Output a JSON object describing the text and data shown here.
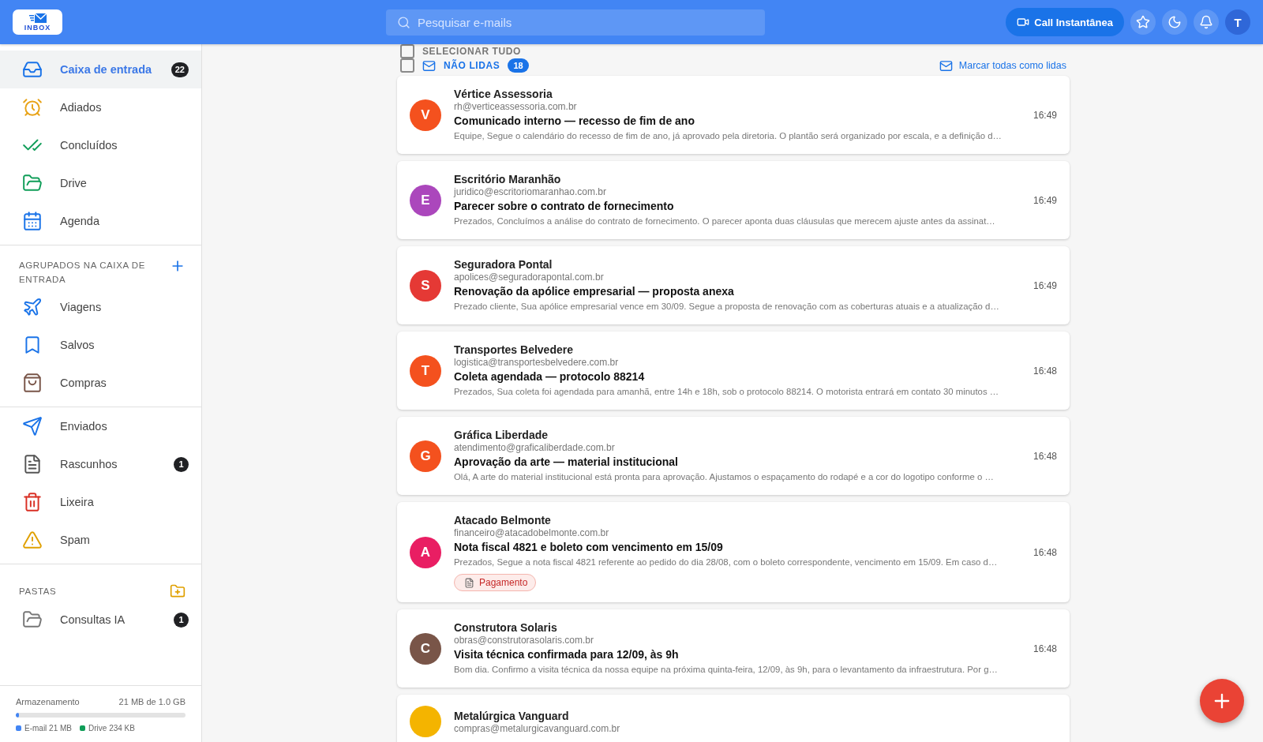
{
  "header": {
    "logo_text": "INBOX",
    "search": {
      "placeholder": "Pesquisar e-mails"
    },
    "call_button": "Call Instantânea",
    "avatar": "T"
  },
  "sidebar": {
    "main": [
      {
        "label": "Caixa de entrada",
        "count": "22",
        "selected": true
      },
      {
        "label": "Adiados",
        "selected": false
      },
      {
        "label": "Concluídos",
        "selected": false
      },
      {
        "label": "Drive",
        "selected": false
      },
      {
        "label": "Agenda",
        "selected": false
      }
    ],
    "grouped": {
      "title": "AGRUPADOS NA CAIXA DE ENTRADA",
      "items": [
        {
          "label": "Viagens",
          "selected": false
        },
        {
          "label": "Salvos",
          "selected": false
        },
        {
          "label": "Compras",
          "selected": false
        }
      ]
    },
    "system": [
      {
        "label": "Enviados",
        "selected": false
      },
      {
        "label": "Rascunhos",
        "count": "1",
        "selected": false
      },
      {
        "label": "Lixeira",
        "selected": false
      },
      {
        "label": "Spam",
        "selected": false
      }
    ],
    "folders": {
      "title": "PASTAS",
      "items": [
        {
          "label": "Consultas IA",
          "count": "1",
          "selected": false
        }
      ]
    },
    "storage": {
      "label": "Armazenamento",
      "usage": "21 MB de 1.0 GB",
      "level": 0.02,
      "legend": [
        {
          "label": "E-mail 21 MB",
          "color": "#4285f4"
        },
        {
          "label": "Drive 234 KB",
          "color": "#0f9d58"
        }
      ]
    }
  },
  "list": {
    "select_all": {
      "label": "SELECIONAR TUDO",
      "checked": false
    },
    "group": {
      "label": "NÃO LIDAS",
      "count": "18",
      "checked": false,
      "mark_all": "Marcar todas como lidas"
    },
    "emails": [
      {
        "letter": "V",
        "color": "#f4511e",
        "sender": "Vértice Assessoria",
        "address": "rh@verticeassessoria.com.br",
        "subject": "Comunicado interno — recesso de fim de ano",
        "preview": "Equipe, Segue o calendário do recesso de fim de ano, já aprovado pela diretoria. O plantão será organizado por escala, e a definição d…",
        "time": "16:49"
      },
      {
        "letter": "E",
        "color": "#ab47bc",
        "sender": "Escritório Maranhão",
        "address": "juridico@escritoriomaranhao.com.br",
        "subject": "Parecer sobre o contrato de fornecimento",
        "preview": "Prezados, Concluímos a análise do contrato de fornecimento. O parecer aponta duas cláusulas que merecem ajuste antes da assinat…",
        "time": "16:49"
      },
      {
        "letter": "S",
        "color": "#e53935",
        "sender": "Seguradora Pontal",
        "address": "apolices@seguradorapontal.com.br",
        "subject": "Renovação da apólice empresarial — proposta anexa",
        "preview": "Prezado cliente, Sua apólice empresarial vence em 30/09. Segue a proposta de renovação com as coberturas atuais e a atualização d…",
        "time": "16:49"
      },
      {
        "letter": "T",
        "color": "#f4511e",
        "sender": "Transportes Belvedere",
        "address": "logistica@transportesbelvedere.com.br",
        "subject": "Coleta agendada — protocolo 88214",
        "preview": "Prezados, Sua coleta foi agendada para amanhã, entre 14h e 18h, sob o protocolo 88214. O motorista entrará em contato 30 minutos …",
        "time": "16:48"
      },
      {
        "letter": "G",
        "color": "#f4511e",
        "sender": "Gráfica Liberdade",
        "address": "atendimento@graficaliberdade.com.br",
        "subject": "Aprovação da arte — material institucional",
        "preview": "Olá, A arte do material institucional está pronta para aprovação. Ajustamos o espaçamento do rodapé e a cor do logotipo conforme o …",
        "time": "16:48"
      },
      {
        "letter": "A",
        "color": "#e91e63",
        "sender": "Atacado Belmonte",
        "address": "financeiro@atacadobelmonte.com.br",
        "subject": "Nota fiscal 4821 e boleto com vencimento em 15/09",
        "preview": "Prezados, Segue a nota fiscal 4821 referente ao pedido do dia 28/08, com o boleto correspondente, vencimento em 15/09. Em caso d…",
        "time": "16:48",
        "tag": "Pagamento"
      },
      {
        "letter": "C",
        "color": "#795548",
        "sender": "Construtora Solaris",
        "address": "obras@construtorasolaris.com.br",
        "subject": "Visita técnica confirmada para 12/09, às 9h",
        "preview": "Bom dia. Confirmo a visita técnica da nossa equipe na próxima quinta-feira, 12/09, às 9h, para o levantamento da infraestrutura. Por g…",
        "time": "16:48"
      },
      {
        "color": "#f4b400",
        "sender": "Metalúrgica Vanguard",
        "address": "compras@metalurgicavanguard.com.br"
      }
    ]
  }
}
